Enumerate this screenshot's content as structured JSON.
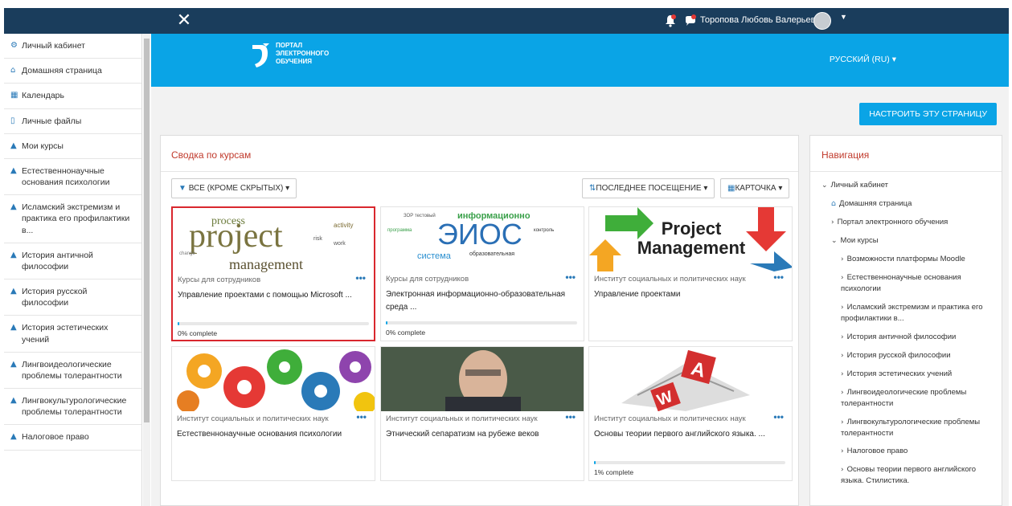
{
  "topbar": {
    "user_name": "Торопова Любовь Валерьевна",
    "notifications_badge": "",
    "messages_badge": ""
  },
  "header": {
    "logo_lines": [
      "ПОРТАЛ",
      "ЭЛЕКТРОННОГО",
      "ОБУЧЕНИЯ"
    ],
    "language": "РУССКИЙ (RU) ▾"
  },
  "sidebar": {
    "items": [
      {
        "label": "Личный кабинет",
        "icon": "dashboard-icon",
        "glyph": "⚙"
      },
      {
        "label": "Домашняя страница",
        "icon": "home-icon",
        "glyph": "⌂"
      },
      {
        "label": "Календарь",
        "icon": "calendar-icon",
        "glyph": "▦"
      },
      {
        "label": "Личные файлы",
        "icon": "file-icon",
        "glyph": "▯"
      },
      {
        "label": "Мои курсы",
        "icon": "graduation-cap-icon",
        "glyph": "▲"
      }
    ],
    "courses": [
      "Естественнонаучные основания психологии",
      "Исламский экстремизм и практика его профилактики в...",
      "История античной философии",
      "История русской философии",
      "История эстетических учений",
      "Лингвоидеологические проблемы толерантности",
      "Лингвокультурологические проблемы толерантности",
      "Налоговое право"
    ]
  },
  "actions": {
    "configure_page": "НАСТРОИТЬ ЭТУ СТРАНИЦУ"
  },
  "overview": {
    "title": "Сводка по курсам",
    "filter": "ВСЕ (КРОМЕ СКРЫТЫХ) ▾",
    "sort": "ПОСЛЕДНЕЕ ПОСЕЩЕНИЕ ▾",
    "view": "КАРТОЧКА ▾",
    "cards": [
      {
        "category": "Курсы для сотрудников",
        "name": "Управление проектами с помощью Microsoft ...",
        "progress_label": "0% complete",
        "progress": 0,
        "image": "project-management-wordcloud"
      },
      {
        "category": "Курсы для сотрудников",
        "name": "Электронная информационно-образовательная среда ...",
        "progress_label": "0% complete",
        "progress": 0,
        "image": "eios-wordcloud"
      },
      {
        "category": "Институт социальных и политических наук",
        "name": "Управление проектами",
        "progress_label": "",
        "progress": null,
        "image": "project-management-arrows"
      },
      {
        "category": "Институт социальных и политических наук",
        "name": "Естественнонаучные основания психологии",
        "progress_label": "",
        "progress": null,
        "image": "colorful-gears"
      },
      {
        "category": "Институт социальных и политических наук",
        "name": "Этнический сепаратизм на рубеже веков",
        "progress_label": "",
        "progress": null,
        "image": "portrait-man"
      },
      {
        "category": "Институт социальных и политических наук",
        "name": "Основы теории первого английского языка. ...",
        "progress_label": "1% complete",
        "progress": 1,
        "image": "book-letters"
      }
    ]
  },
  "navigation": {
    "title": "Навигация",
    "items": [
      {
        "label": "Личный кабинет",
        "level": 0,
        "chev": "⌄"
      },
      {
        "label": "Домашняя страница",
        "level": 1,
        "chev": ""
      },
      {
        "label": "Портал электронного обучения",
        "level": 1,
        "chev": "›"
      },
      {
        "label": "Мои курсы",
        "level": 1,
        "chev": "⌄"
      },
      {
        "label": "Возможности платформы Moodle",
        "level": 2,
        "chev": "›"
      },
      {
        "label": "Естественнонаучные основания психологии",
        "level": 2,
        "chev": "›"
      },
      {
        "label": "Исламский экстремизм и практика его профилактики в...",
        "level": 2,
        "chev": "›"
      },
      {
        "label": "История античной философии",
        "level": 2,
        "chev": "›"
      },
      {
        "label": "История русской философии",
        "level": 2,
        "chev": "›"
      },
      {
        "label": "История эстетических учений",
        "level": 2,
        "chev": "›"
      },
      {
        "label": "Лингвоидеологические проблемы толерантности",
        "level": 2,
        "chev": "›"
      },
      {
        "label": "Лингвокультурологические проблемы толерантности",
        "level": 2,
        "chev": "›"
      },
      {
        "label": "Налоговое право",
        "level": 2,
        "chev": "›"
      },
      {
        "label": "Основы теории первого английского языка. Стилистика.",
        "level": 2,
        "chev": "›"
      }
    ]
  },
  "colors": {
    "topbar": "#1a3d5c",
    "header": "#0aa4e6",
    "accent": "#0aa4e6",
    "title_red": "#c0392b",
    "highlight": "#d9272e"
  }
}
